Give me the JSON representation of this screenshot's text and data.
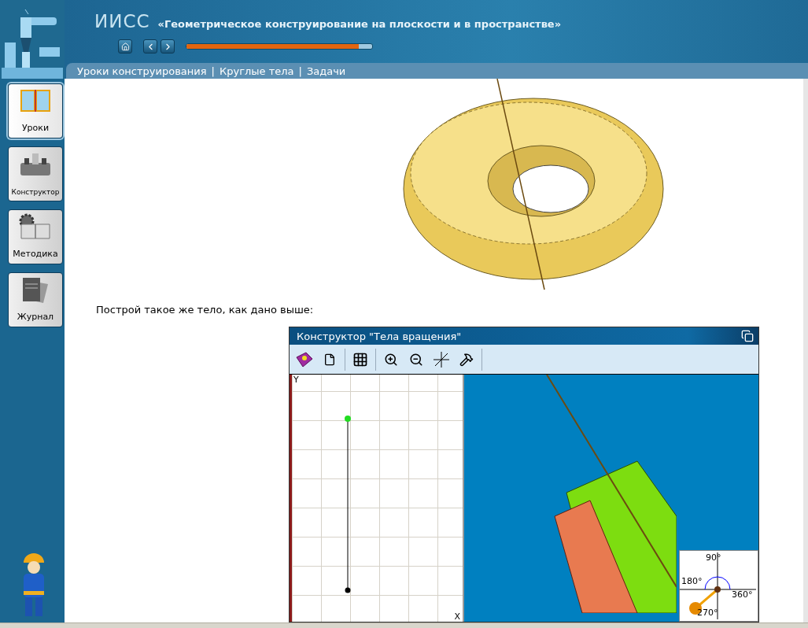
{
  "app": {
    "title": "ИИСС",
    "subtitle": "«Геометрическое конструирование на плоскости и в пространстве»"
  },
  "progress": {
    "level": 0.93
  },
  "breadcrumb": {
    "separator": "|",
    "items": [
      "Уроки конструирования",
      "Круглые тела",
      "Задачи"
    ]
  },
  "sidebar": {
    "items": [
      {
        "kind": "lessons",
        "label": "Уроки",
        "selected": true
      },
      {
        "kind": "constructor",
        "label": "Конструктор",
        "selected": false
      },
      {
        "kind": "methods",
        "label": "Методика",
        "selected": false
      },
      {
        "kind": "journal",
        "label": "Журнал",
        "selected": false
      }
    ]
  },
  "task": {
    "prompt": "Построй такое же тело, как дано выше:"
  },
  "constructor": {
    "title": "Конструктор \"Тела вращения\"",
    "profile": {
      "y_label": "Y",
      "x_label": "X"
    },
    "angle": {
      "labels": [
        "90°",
        "180°",
        "360°",
        "270°"
      ]
    }
  }
}
